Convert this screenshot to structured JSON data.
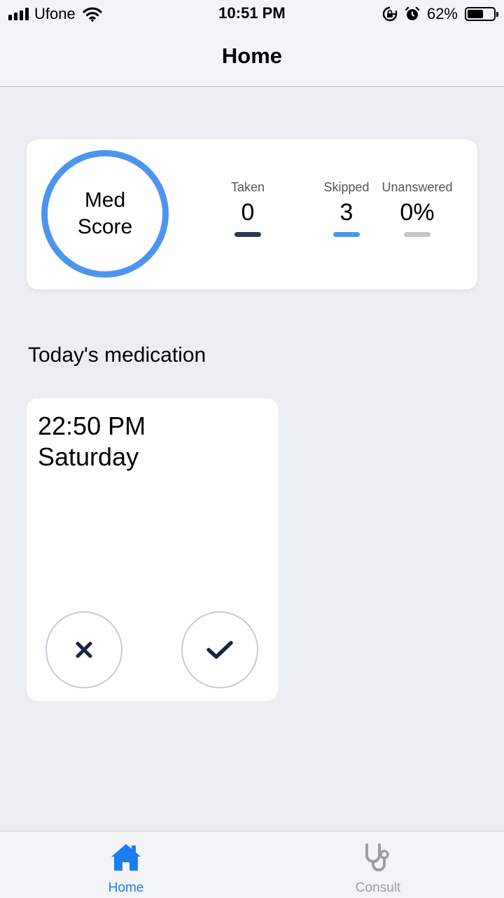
{
  "status_bar": {
    "carrier": "Ufone",
    "time": "10:51 PM",
    "battery": "62%",
    "battery_level": 0.62,
    "icons": [
      "signal-icon",
      "wifi-icon",
      "rotation-lock-icon",
      "alarm-icon",
      "battery-icon"
    ]
  },
  "nav": {
    "title": "Home"
  },
  "score_card": {
    "score_label": "Med Score",
    "stats": [
      {
        "label": "Taken",
        "value": "0",
        "color": "#2e3a55"
      },
      {
        "label": "Skipped",
        "value": "3",
        "color": "#4d94f0"
      },
      {
        "label": "Unanswered",
        "value": "0%",
        "color": "#c4c6cf"
      }
    ]
  },
  "section": {
    "heading": "Today's medication"
  },
  "medication": {
    "time": "22:50 PM",
    "day": "Saturday",
    "skip_icon": "close-icon",
    "take_icon": "check-icon"
  },
  "tabs": [
    {
      "label": "Home",
      "icon": "home-icon",
      "active": true
    },
    {
      "label": "Consult",
      "icon": "stethoscope-icon",
      "active": false
    }
  ],
  "colors": {
    "accent": "#4d94f0",
    "tab_active": "#1a7ef0",
    "tab_inactive": "#9a9ea6",
    "action_icon": "#1a2440"
  }
}
